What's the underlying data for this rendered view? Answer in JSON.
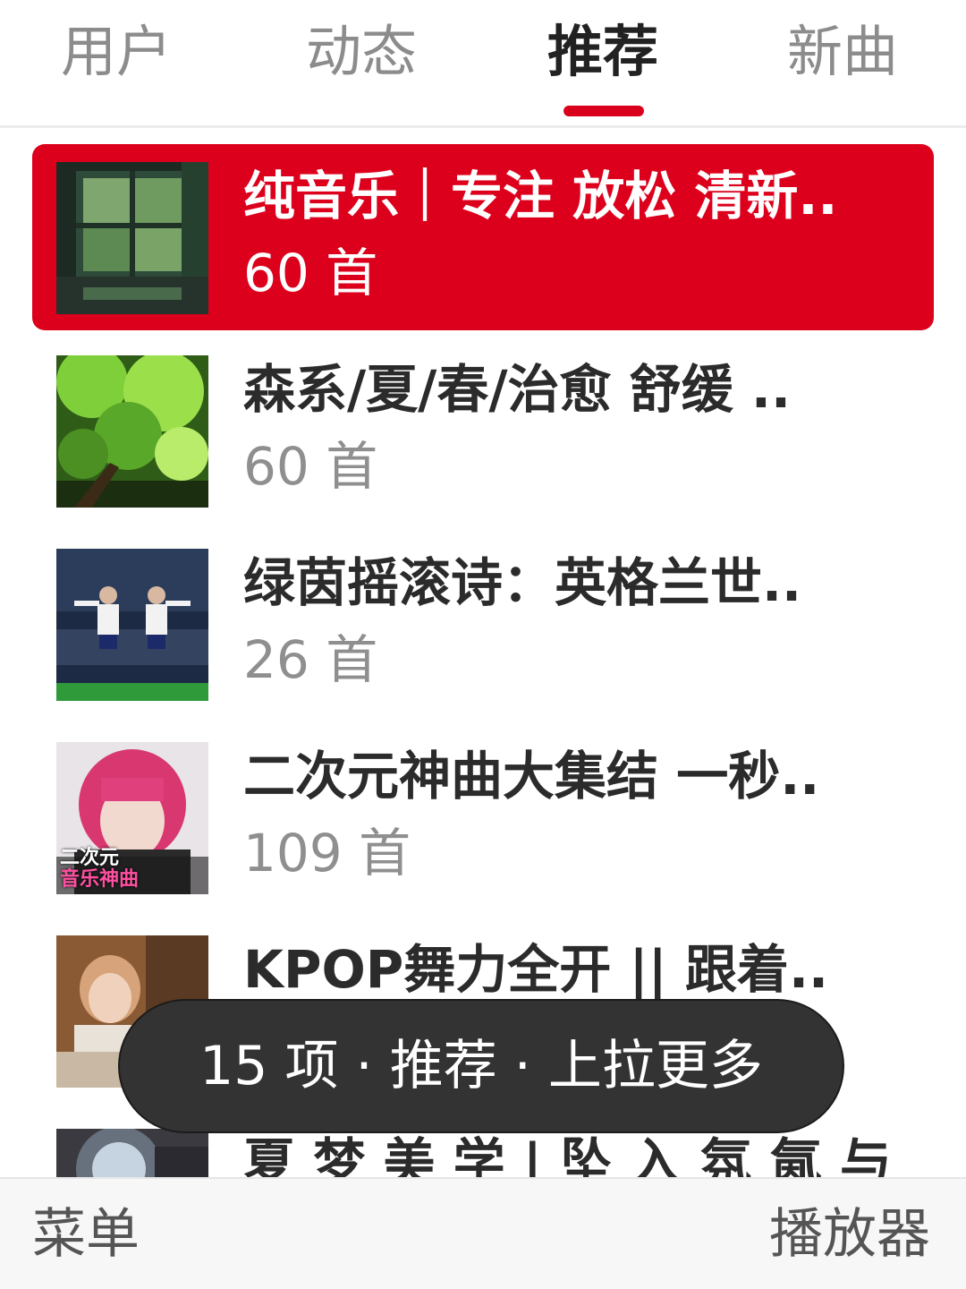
{
  "tabs": [
    {
      "label": "用户",
      "active": false
    },
    {
      "label": "动态",
      "active": false
    },
    {
      "label": "推荐",
      "active": true
    },
    {
      "label": "新曲",
      "active": false
    }
  ],
  "accent_color": "#dc001c",
  "playlists": [
    {
      "title": "纯音乐｜专注 放松 清新..",
      "count": "60 首",
      "selected": true,
      "cover": "window-rain-cover"
    },
    {
      "title": "森系/夏/春/治愈 舒缓 ..",
      "count": "60 首",
      "selected": false,
      "cover": "green-leaves-cover"
    },
    {
      "title": "绿茵摇滚诗：英格兰世..",
      "count": "26 首",
      "selected": false,
      "cover": "football-players-cover"
    },
    {
      "title": "二次元神曲大集结 一秒..",
      "count": "109 首",
      "selected": false,
      "cover": "anime-pink-hair-cover",
      "cover_text": [
        "二次元",
        "音乐神曲"
      ]
    },
    {
      "title": "KPOP舞力全开 || 跟着..",
      "count": "",
      "selected": false,
      "cover": "kpop-girl-cover"
    },
    {
      "title": "夏 梦 美 学 | 坠 入 氛 氤 与 ..",
      "count": "",
      "selected": false,
      "cover": "summer-light-cover"
    }
  ],
  "toast": {
    "text": "15 项 · 推荐 · 上拉更多"
  },
  "softkeys": {
    "left": "菜单",
    "right": "播放器"
  }
}
